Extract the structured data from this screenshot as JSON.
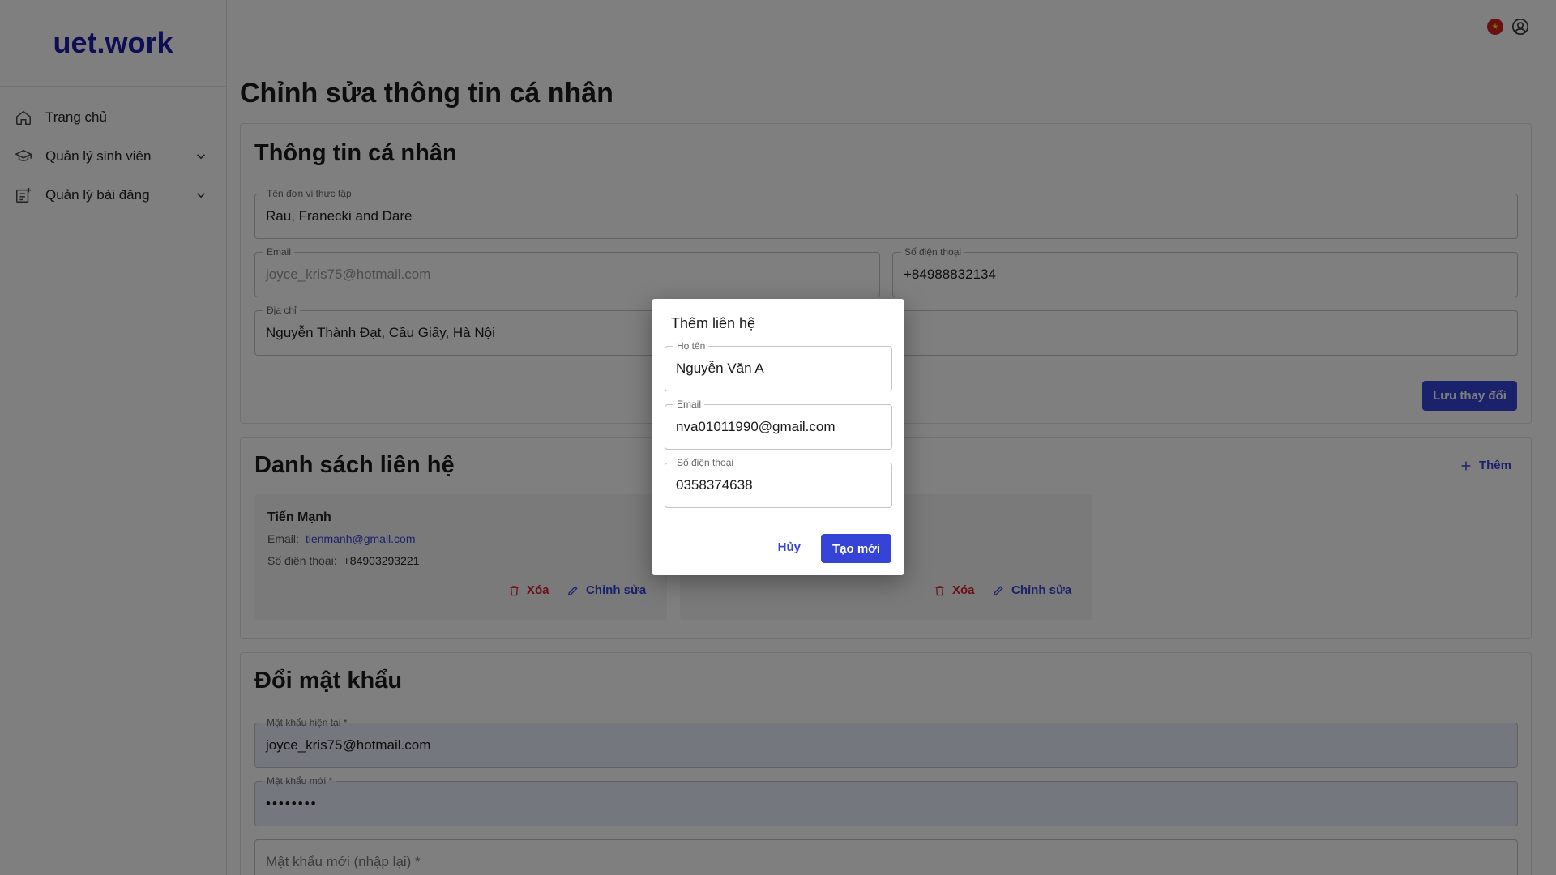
{
  "app": {
    "logo": "uet.work"
  },
  "sidebar": {
    "items": [
      {
        "label": "Trang chủ",
        "icon": "home-icon"
      },
      {
        "label": "Quản lý sinh viên",
        "icon": "graduation-cap-icon"
      },
      {
        "label": "Quản lý bài đăng",
        "icon": "post-add-icon"
      }
    ]
  },
  "header": {
    "language_icon": "vietnam-flag-icon",
    "account_icon": "user-circle-icon"
  },
  "page": {
    "title": "Chỉnh sửa thông tin cá nhân"
  },
  "personal": {
    "title": "Thông tin cá nhân",
    "company_label": "Tên đơn vị thực tập",
    "company_value": "Rau, Franecki and Dare",
    "email_label": "Email",
    "email_value": "joyce_kris75@hotmail.com",
    "phone_label": "Số điện thoại",
    "phone_value": "+84988832134",
    "address_label": "Địa chỉ",
    "address_value": "Nguyễn Thành Đạt, Cầu Giấy, Hà Nội",
    "save_label": "Lưu thay đổi"
  },
  "contacts": {
    "title": "Danh sách liên hệ",
    "add_label": "Thêm",
    "items": [
      {
        "name": "Tiến Mạnh",
        "email_label": "Email:",
        "email": "tienmanh@gmail.com",
        "phone_label": "Số điện thoại:",
        "phone": "+84903293221",
        "delete_label": "Xóa",
        "edit_label": "Chỉnh sửa"
      },
      {
        "delete_label": "Xóa",
        "edit_label": "Chỉnh sửa"
      }
    ]
  },
  "password": {
    "title": "Đổi mật khẩu",
    "current_label": "Mật khẩu hiện tại *",
    "current_value": "joyce_kris75@hotmail.com",
    "new_label": "Mật khẩu mới *",
    "new_value": "••••••••",
    "confirm_placeholder": "Mật khẩu mới (nhập lại) *"
  },
  "dialog": {
    "title": "Thêm liên hệ",
    "name_label": "Họ tên",
    "name_value": "Nguyễn Văn A",
    "email_label": "Email",
    "email_value": "nva01011990@gmail.com",
    "phone_label": "Số điện thoại",
    "phone_value": "0358374638",
    "cancel_label": "Hủy",
    "create_label": "Tạo mới"
  },
  "colors": {
    "brand": "#1c1ca8",
    "primary": "#3544d6",
    "danger": "#d4212b"
  }
}
